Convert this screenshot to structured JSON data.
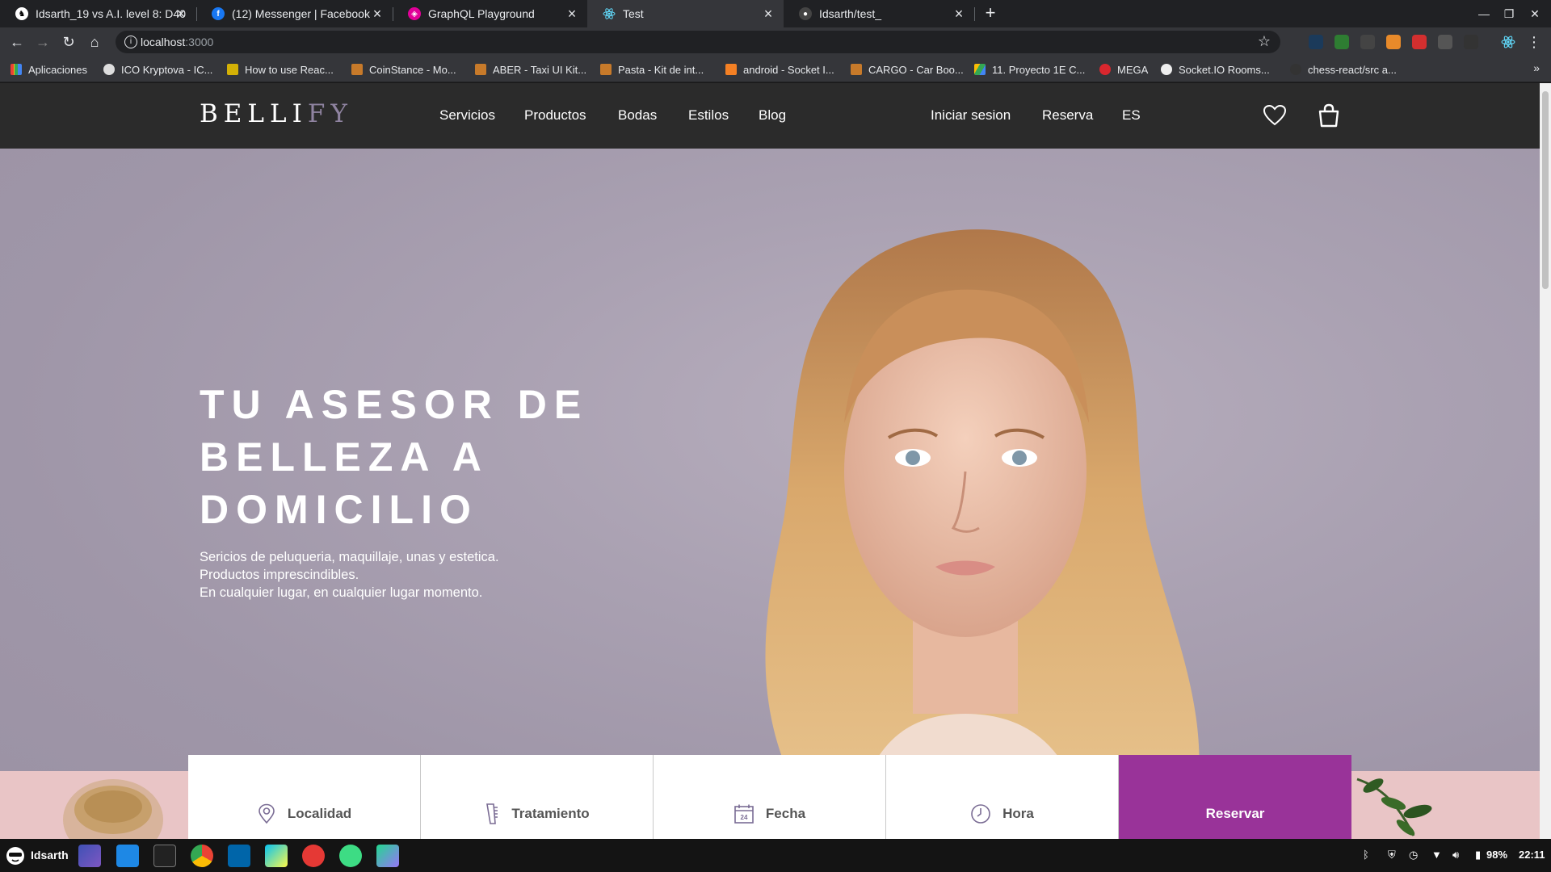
{
  "browser": {
    "tabs": [
      {
        "title": "Idsarth_19 vs A.I. level 8: D40",
        "favicon": "lichess-icon",
        "color": "#ffffff"
      },
      {
        "title": "(12) Messenger | Facebook",
        "favicon": "facebook-icon",
        "color": "#1877f2"
      },
      {
        "title": "GraphQL Playground",
        "favicon": "graphql-icon",
        "color": "#e10098"
      },
      {
        "title": "Test",
        "favicon": "react-icon",
        "color": "#61dafb",
        "active": true
      },
      {
        "title": "Idsarth/test_",
        "favicon": "github-icon",
        "color": "#444444"
      }
    ],
    "url_host": "localhost",
    "url_port": ":3000",
    "bookmarks": [
      "Aplicaciones",
      "ICO Kryptova - IC...",
      "How to use Reac...",
      "CoinStance - Mo...",
      "ABER - Taxi UI Kit...",
      "Pasta - Kit de int...",
      "android - Socket I...",
      "CARGO - Car Boo...",
      "11. Proyecto 1E C...",
      "MEGA",
      "Socket.IO Rooms...",
      "chess-react/src a..."
    ]
  },
  "site": {
    "logo_main": "BELLI",
    "logo_accent": "FY",
    "nav": [
      "Servicios",
      "Productos",
      "Bodas",
      "Estilos",
      "Blog"
    ],
    "nav_right": [
      "Iniciar sesion",
      "Reserva",
      "ES"
    ],
    "hero": {
      "title_lines": [
        "TU ASESOR DE",
        "BELLEZA A",
        "DOMICILIO"
      ],
      "subtitle_lines": [
        "Sericios de peluqueria, maquillaje, unas y estetica.",
        "Productos imprescindibles.",
        "En cualquier lugar, en cualquier lugar momento."
      ]
    },
    "booking": {
      "locality": "Localidad",
      "treatment": "Tratamiento",
      "date": "Fecha",
      "time": "Hora",
      "submit": "Reservar"
    },
    "colors": {
      "accent": "#993399",
      "nav_bg": "#2b2b2b",
      "hero_bg": "#a89fb0"
    }
  },
  "taskbar": {
    "user": "Idsarth",
    "battery": "98%",
    "clock": "22:11"
  }
}
